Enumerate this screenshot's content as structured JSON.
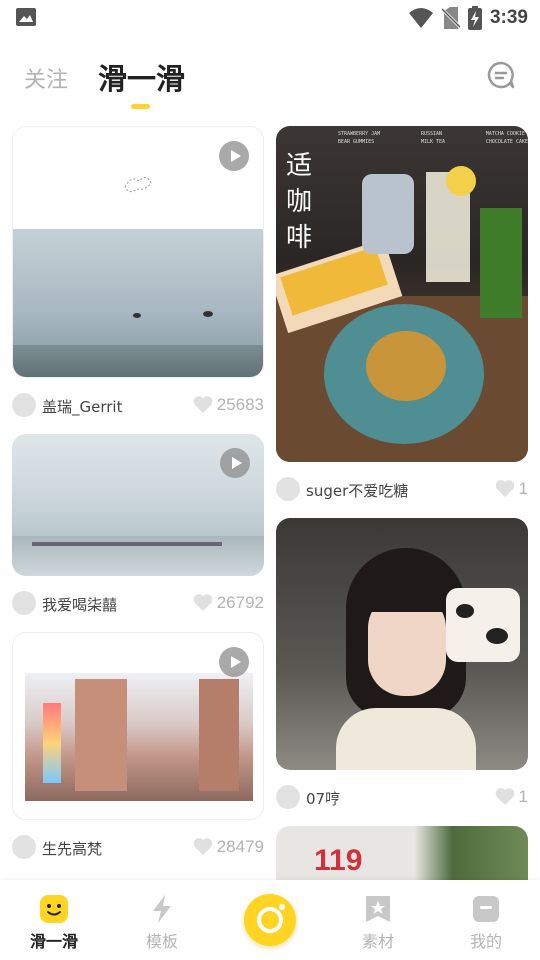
{
  "status_bar": {
    "time": "3:39"
  },
  "top_tabs": {
    "follow": "关注",
    "slide": "滑一滑"
  },
  "feed": {
    "left": [
      {
        "user": "盖瑞_Gerrit",
        "likes": "25683",
        "video": true
      },
      {
        "user": "我爱喝柒囍",
        "likes": "26792",
        "video": true
      },
      {
        "user": "生先高梵",
        "likes": "28479",
        "video": true
      }
    ],
    "right": [
      {
        "user": "suger不爱吃糖",
        "likes": "1",
        "image_text": "适\n咖\n啡",
        "menu": [
          "STRAWBERRY JAM\nBEAR GUMMIES",
          "RUSSIAN\nMILK TEA",
          "MATCHA COOKIE\nCHOCOLATE CAKE"
        ]
      },
      {
        "user": "07哼",
        "likes": "1"
      },
      {
        "image_text": "119"
      }
    ]
  },
  "bottom_nav": {
    "items": [
      {
        "label": "滑一滑",
        "active": true
      },
      {
        "label": "模板"
      },
      {
        "label": "素材"
      },
      {
        "label": "我的"
      }
    ]
  },
  "colors": {
    "accent": "#ffd22e",
    "inactive": "#b5b5b5"
  }
}
